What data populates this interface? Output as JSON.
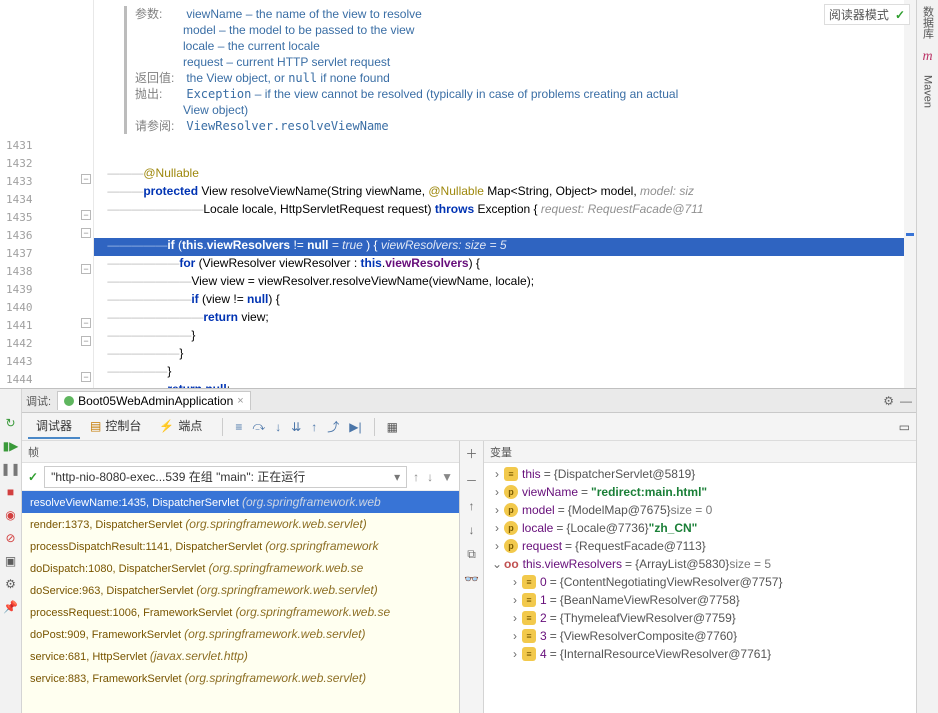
{
  "reader_mode_label": "阅读器模式",
  "right_tools": {
    "datasource": "数据库",
    "maven": "Maven"
  },
  "doc": {
    "params_label": "参数:",
    "params": [
      "viewName – the name of the view to resolve",
      "model – the model to be passed to the view",
      "locale – the current locale",
      "request – current HTTP servlet request"
    ],
    "returns_label": "返回值:",
    "returns": "the View object, or null if none found",
    "throws_label": "抛出:",
    "throws": "Exception – if the view cannot be resolved (typically in case of problems creating an actual View object)",
    "see_label": "请参阅:",
    "see": "ViewResolver.resolveViewName"
  },
  "lines": {
    "start": 1431,
    "rows": [
      {
        "n": 1431,
        "html": "<span class='m-dash'>———</span><span class='ann'>@Nullable</span>"
      },
      {
        "n": 1432,
        "html": "<span class='m-dash'>———</span><span class='kw'>protected</span> View <span class='id2'>resolveViewName</span>(String viewName, <span class='ann'>@Nullable</span> Map&lt;String, Object&gt; model,   <span class='hint'>model:  siz</span>"
      },
      {
        "n": 1433,
        "html": "<span class='m-dash'>————————</span>Locale locale, HttpServletRequest request) <span class='kw'>throws</span> Exception {   <span class='hint'>request: RequestFacade@711</span>"
      },
      {
        "n": 1434,
        "html": ""
      },
      {
        "n": 1435,
        "hi": true,
        "html": "<span class='m-dash' style='color:#9cb8e6'>—————</span><span class='kw'>if</span> (<span class='kw'>this</span>.<span class='field'>viewResolvers</span> != <span class='kw'>null</span> <span class='hint'>= true</span> ) {   <span class='hint'>viewResolvers:  size = 5</span>"
      },
      {
        "n": 1436,
        "html": "<span class='m-dash'>——————</span><span class='kw'>for</span> (ViewResolver viewResolver : <span class='kw'>this</span>.<span class='field'>viewResolvers</span>) {"
      },
      {
        "n": 1437,
        "html": "<span class='m-dash'>———————</span>View view = viewResolver.resolveViewName(viewName, locale);"
      },
      {
        "n": 1438,
        "html": "<span class='m-dash'>———————</span><span class='kw'>if</span> (view != <span class='kw'>null</span>) {"
      },
      {
        "n": 1439,
        "html": "<span class='m-dash'>————————</span><span class='kw'>return</span> view;"
      },
      {
        "n": 1440,
        "html": "<span class='m-dash'>———————</span>}"
      },
      {
        "n": 1441,
        "html": "<span class='m-dash'>——————</span>}"
      },
      {
        "n": 1442,
        "html": "<span class='m-dash'>—————</span>}"
      },
      {
        "n": 1443,
        "html": "<span class='m-dash'>—————</span><span class='kw'>return null</span>;"
      },
      {
        "n": 1444,
        "html": "<span class='m-dash'>———</span>}"
      }
    ]
  },
  "debug": {
    "label": "调试:",
    "run_config": "Boot05WebAdminApplication",
    "subtabs": {
      "debugger": "调试器",
      "console": "控制台",
      "breakpoints": "端点"
    },
    "frames_header": "帧",
    "vars_header": "变量",
    "thread": "\"http-nio-8080-exec...539 在组 \"main\": 正在运行",
    "frames": [
      {
        "m": "resolveViewName:1435, DispatcherServlet",
        "p": "(org.springframework.web",
        "sel": true
      },
      {
        "m": "render:1373, DispatcherServlet",
        "p": "(org.springframework.web.servlet)"
      },
      {
        "m": "processDispatchResult:1141, DispatcherServlet",
        "p": "(org.springframework"
      },
      {
        "m": "doDispatch:1080, DispatcherServlet",
        "p": "(org.springframework.web.se"
      },
      {
        "m": "doService:963, DispatcherServlet",
        "p": "(org.springframework.web.servlet)"
      },
      {
        "m": "processRequest:1006, FrameworkServlet",
        "p": "(org.springframework.web.se"
      },
      {
        "m": "doPost:909, FrameworkServlet",
        "p": "(org.springframework.web.servlet)"
      },
      {
        "m": "service:681, HttpServlet",
        "p": "(javax.servlet.http)"
      },
      {
        "m": "service:883, FrameworkServlet",
        "p": "(org.springframework.web.servlet)"
      }
    ],
    "vars": [
      {
        "d": 0,
        "tw": ">",
        "icon": "f",
        "name": "this",
        "val": "{DispatcherServlet@5819}"
      },
      {
        "d": 0,
        "tw": ">",
        "icon": "p",
        "name": "viewName",
        "str": "\"redirect:main.html\""
      },
      {
        "d": 0,
        "tw": ">",
        "icon": "p",
        "name": "model",
        "val": "{ModelMap@7675}",
        "extra": "  size = 0"
      },
      {
        "d": 0,
        "tw": ">",
        "icon": "p",
        "name": "locale",
        "val": "{Locale@7736}",
        "str": " \"zh_CN\""
      },
      {
        "d": 0,
        "tw": ">",
        "icon": "p",
        "name": "request",
        "val": "{RequestFacade@7113}"
      },
      {
        "d": 0,
        "tw": "v",
        "icon": "oo",
        "name": "this.viewResolvers",
        "val": "{ArrayList@5830}",
        "extra": "  size = 5"
      },
      {
        "d": 1,
        "tw": ">",
        "icon": "f",
        "name": "0",
        "val": "{ContentNegotiatingViewResolver@7757}"
      },
      {
        "d": 1,
        "tw": ">",
        "icon": "f",
        "name": "1",
        "val": "{BeanNameViewResolver@7758}"
      },
      {
        "d": 1,
        "tw": ">",
        "icon": "f",
        "name": "2",
        "val": "{ThymeleafViewResolver@7759}"
      },
      {
        "d": 1,
        "tw": ">",
        "icon": "f",
        "name": "3",
        "val": "{ViewResolverComposite@7760}"
      },
      {
        "d": 1,
        "tw": ">",
        "icon": "f",
        "name": "4",
        "val": "{InternalResourceViewResolver@7761}"
      }
    ]
  }
}
